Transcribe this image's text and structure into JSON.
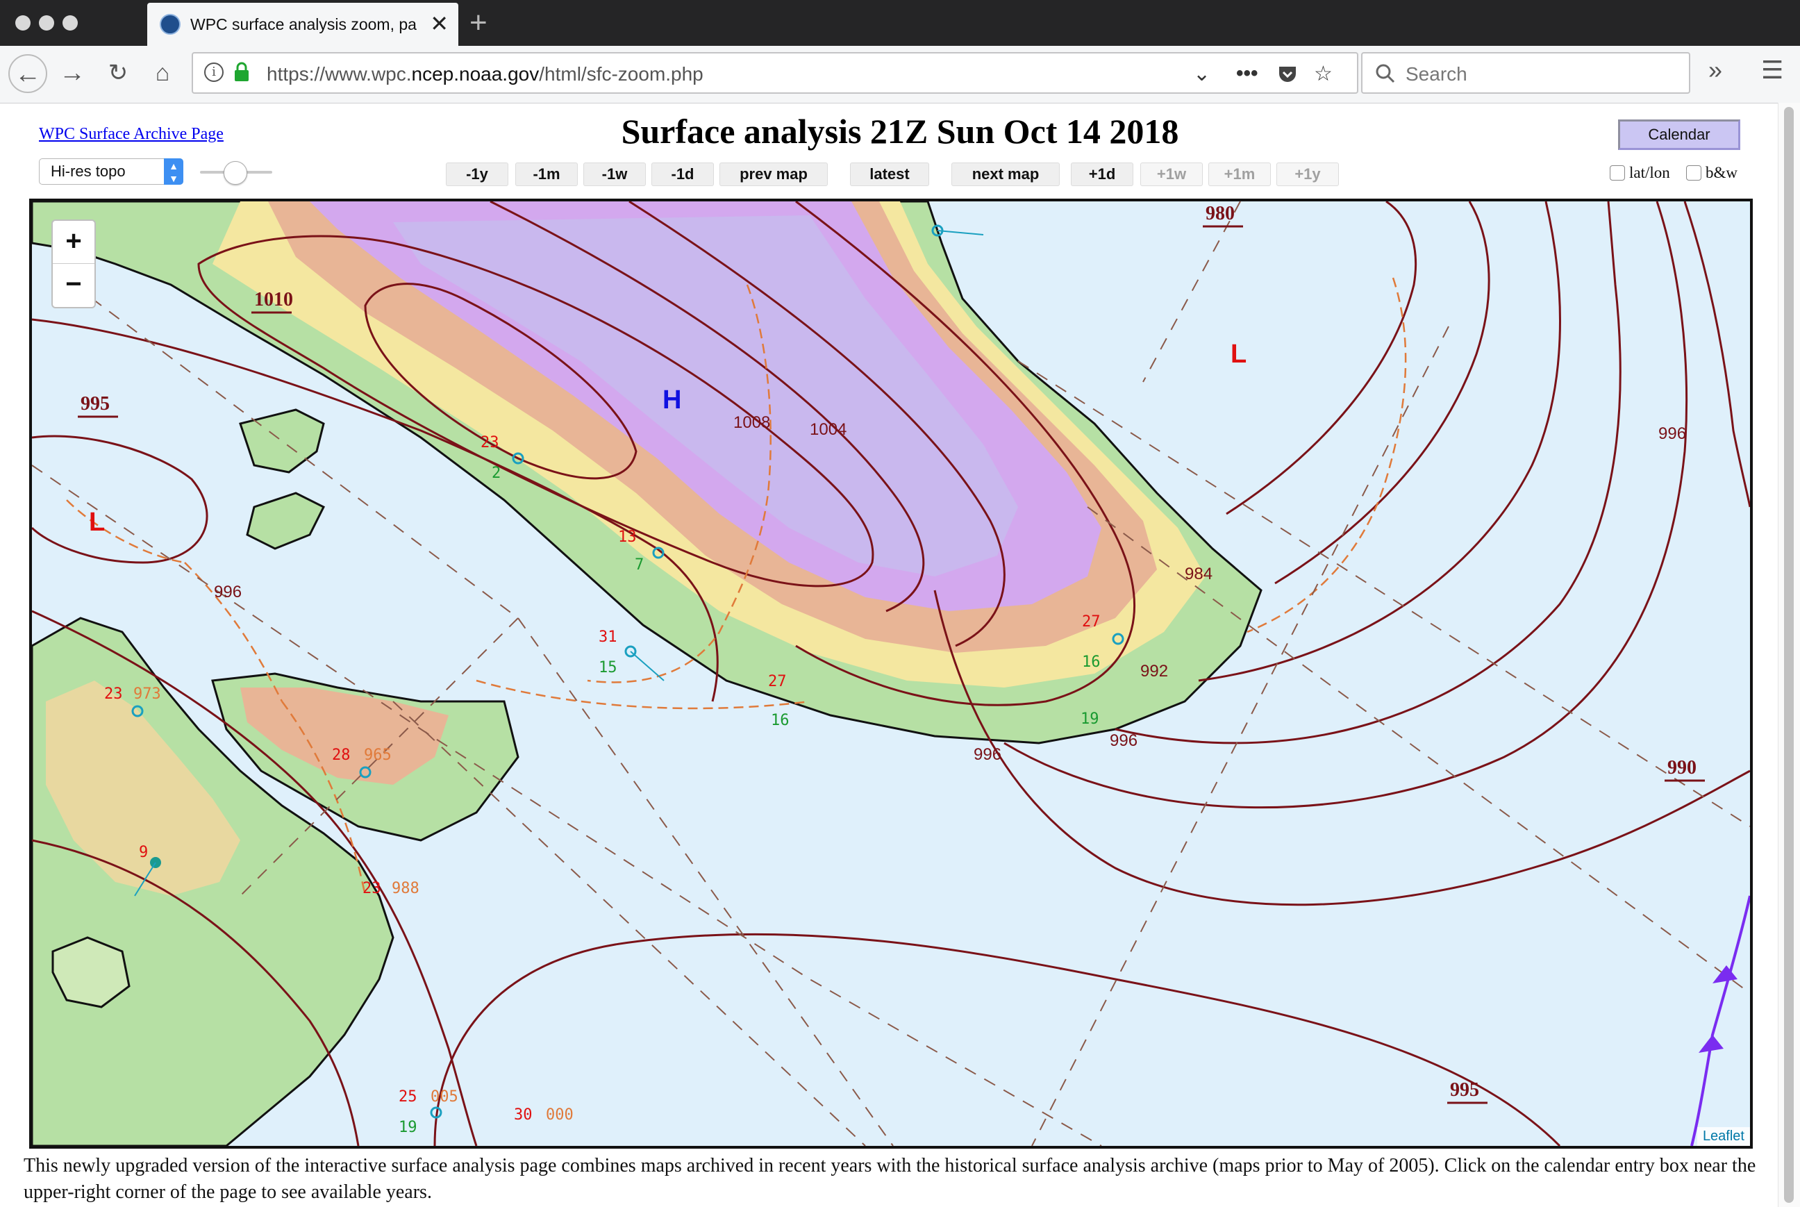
{
  "browser": {
    "tab_title": "WPC surface analysis zoom, pa",
    "url_prefix": "https://www.wpc.",
    "url_domain": "ncep.noaa.gov",
    "url_suffix": "/html/sfc-zoom.php",
    "search_placeholder": "Search"
  },
  "header": {
    "archive_link": "WPC Surface Archive Page",
    "title": "Surface analysis 21Z Sun Oct 14 2018",
    "calendar_label": "Calendar"
  },
  "controls": {
    "basemap_select": "Hi-res topo",
    "nav_buttons": [
      "-1y",
      "-1m",
      "-1w",
      "-1d",
      "prev map",
      "latest",
      "next map",
      "+1d",
      "+1w",
      "+1m",
      "+1y"
    ],
    "latlon_label": "lat/lon",
    "bw_label": "b&w"
  },
  "map": {
    "zoom_in": "+",
    "zoom_out": "−",
    "attribution": "Leaflet",
    "high_label": "H",
    "low_label": "L",
    "isobar_labels": [
      "1010",
      "995",
      "980",
      "990",
      "995",
      "1008",
      "1004",
      "996",
      "996",
      "996",
      "996",
      "992",
      "984"
    ],
    "station_numbers": [
      "31",
      "15",
      "27",
      "16",
      "27",
      "16",
      "23",
      "973",
      "28",
      "965",
      "23",
      "988",
      "9",
      "25",
      "005",
      "19",
      "30",
      "000",
      "19",
      "13",
      "23",
      "2",
      "7"
    ]
  },
  "footer": {
    "text": "This newly upgraded version of the interactive surface analysis page combines maps archived in recent years with the historical surface analysis archive (maps prior to May of 2005). Click on the calendar entry box near the upper-right corner of the page to see available years."
  },
  "colors": {
    "isobar": "#7a1218",
    "low": "#e01010",
    "high": "#1010e0",
    "ocean": "#dff0fb",
    "land_green": "#b6e0a4",
    "ice_purple": "#cfa2ec",
    "trough": "#e07a3a"
  }
}
